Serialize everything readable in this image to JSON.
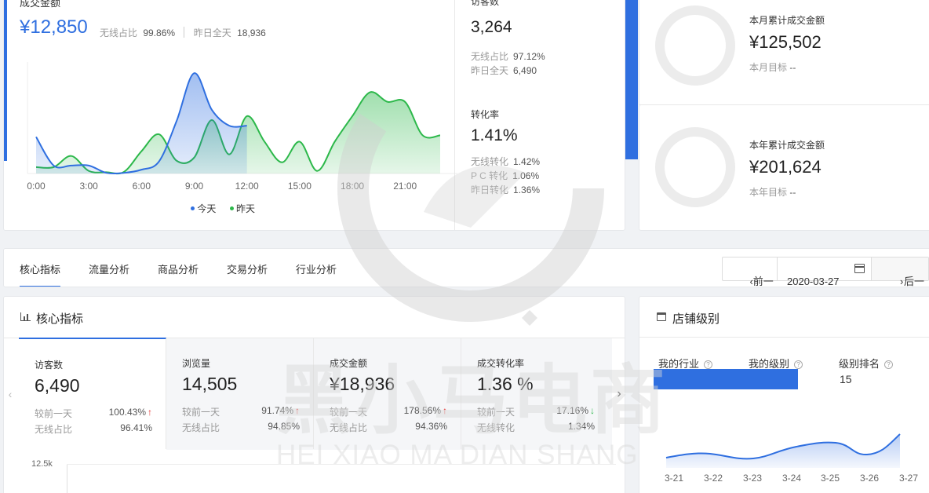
{
  "realtime": {
    "gmv_label": "成交金额",
    "gmv_value": "¥12,850",
    "wireless_ratio_label": "无线占比",
    "wireless_ratio_value": "99.86%",
    "yesterday_label": "昨日全天",
    "yesterday_value": "18,936",
    "legend_today": "今天",
    "legend_yesterday": "昨天",
    "color_today": "#2f6fe0",
    "color_yesterday": "#2cb84a"
  },
  "chart_data": {
    "type": "area",
    "x_ticks": [
      "0:00",
      "3:00",
      "6:00",
      "9:00",
      "12:00",
      "15:00",
      "18:00",
      "21:00"
    ],
    "x": [
      0,
      1,
      2,
      3,
      4,
      5,
      6,
      7,
      8,
      9,
      10,
      11,
      12,
      13,
      14,
      15,
      16,
      17,
      18,
      19,
      20,
      21,
      22,
      23
    ],
    "series": [
      {
        "name": "今天",
        "values": [
          1150,
          250,
          250,
          250,
          20,
          20,
          120,
          380,
          1650,
          3150,
          2000,
          1500,
          1500
        ]
      },
      {
        "name": "昨天",
        "values": [
          200,
          200,
          550,
          80,
          40,
          50,
          700,
          1230,
          400,
          500,
          1680,
          600,
          1800,
          1000,
          350,
          1000,
          80,
          1000,
          1800,
          2550,
          2250,
          2250,
          1200,
          1200
        ]
      }
    ],
    "ylim": [
      0,
      3500
    ],
    "legend": "bottom"
  },
  "visitors": {
    "label": "访客数",
    "value": "3,264",
    "wireless_label": "无线占比",
    "wireless_value": "97.12%",
    "yesterday_label": "昨日全天",
    "yesterday_value": "6,490"
  },
  "conversion": {
    "label": "转化率",
    "value": "1.41%",
    "wireless_label": "无线转化",
    "wireless_value": "1.42%",
    "pc_label": "P C 转化",
    "pc_value": "1.06%",
    "yesterday_label": "昨日转化",
    "yesterday_value": "1.36%"
  },
  "month_total": {
    "label": "本月累计成交金额",
    "value": "¥125,502",
    "target_label": "本月目标",
    "target_value": "--"
  },
  "year_total": {
    "label": "本年累计成交金额",
    "value": "¥201,624",
    "target_label": "本年目标",
    "target_value": "--"
  },
  "tabs": [
    "核心指标",
    "流量分析",
    "商品分析",
    "交易分析",
    "行业分析"
  ],
  "date_nav": {
    "prev_label": "前一天",
    "date_value": "2020-03-27",
    "next_label": "后一天"
  },
  "core": {
    "title": "核心指标",
    "metrics": [
      {
        "title": "访客数",
        "value": "6,490",
        "row1_label": "较前一天",
        "row1_value": "100.43%",
        "row1_trend": "↑",
        "row2_label": "无线占比",
        "row2_value": "96.41%"
      },
      {
        "title": "浏览量",
        "value": "14,505",
        "row1_label": "较前一天",
        "row1_value": "91.74%",
        "row1_trend": "↑",
        "row2_label": "无线占比",
        "row2_value": "94.85%"
      },
      {
        "title": "成交金额",
        "value": "¥18,936",
        "row1_label": "较前一天",
        "row1_value": "178.56%",
        "row1_trend": "↑",
        "row2_label": "无线占比",
        "row2_value": "94.36%"
      },
      {
        "title": "成交转化率",
        "value": "1.36 %",
        "row1_label": "较前一天",
        "row1_value": "17.16%",
        "row1_trend": "↓",
        "row2_label": "无线转化",
        "row2_value": "1.34%"
      }
    ],
    "y_tick": "12.5k"
  },
  "shop_level": {
    "title": "店铺级别",
    "industry_label": "我的行业",
    "level_label": "我的级别",
    "rank_label": "级别排名",
    "rank_value": "15",
    "trend_dates": [
      "3-21",
      "3-22",
      "3-23",
      "3-24",
      "3-25",
      "3-26",
      "3-27"
    ]
  },
  "watermark": {
    "cn": "黑小马电商",
    "en": "HEI XIAO MA DIAN SHANG"
  }
}
